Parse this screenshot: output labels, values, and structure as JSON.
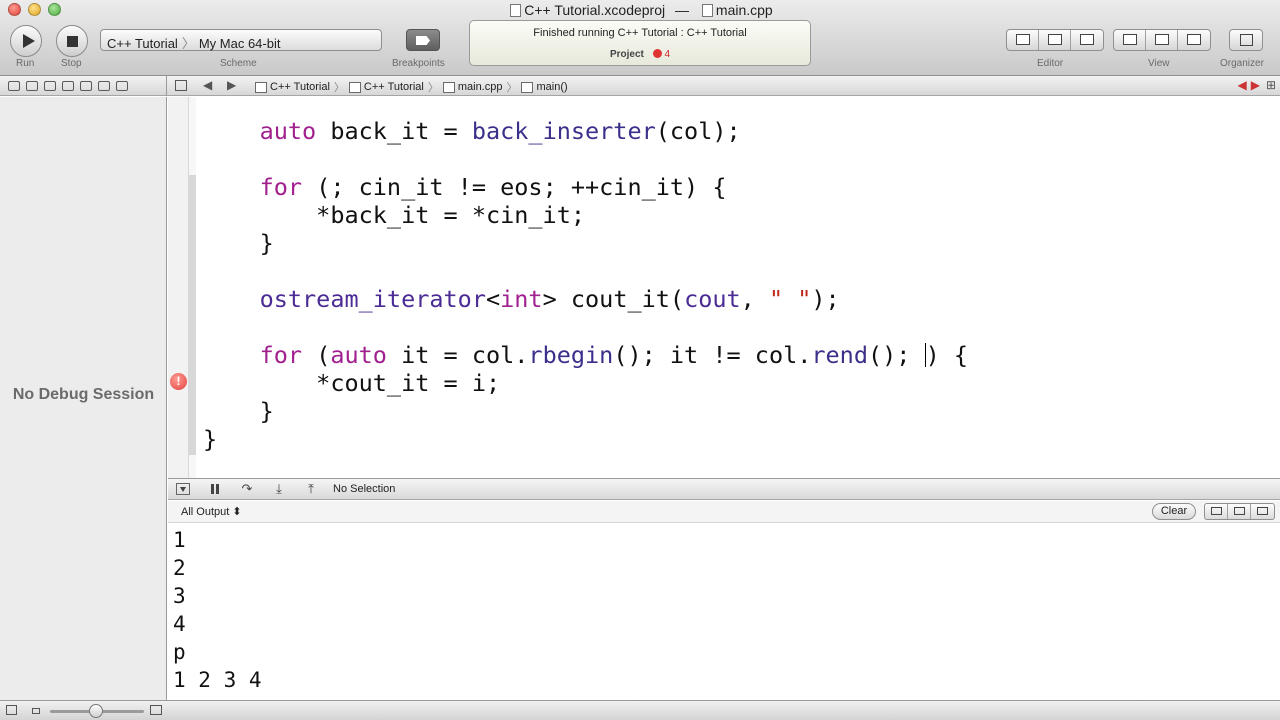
{
  "window": {
    "project_file": "C++ Tutorial.xcodeproj",
    "dash": "—",
    "open_file": "main.cpp"
  },
  "toolbar": {
    "run_label": "Run",
    "stop_label": "Stop",
    "scheme_label": "Scheme",
    "scheme_target": "C++ Tutorial",
    "scheme_destination": "My Mac 64-bit",
    "breakpoints_label": "Breakpoints",
    "editor_label": "Editor",
    "view_label": "View",
    "organizer_label": "Organizer"
  },
  "activity": {
    "status": "Finished running C++ Tutorial : C++ Tutorial",
    "project_label": "Project",
    "error_count": "4"
  },
  "jump_bar": {
    "crumbs": [
      "C++ Tutorial",
      "C++ Tutorial",
      "main.cpp",
      "main()"
    ]
  },
  "debug": {
    "no_session": "No Debug Session",
    "selection": "No Selection"
  },
  "code": {
    "lines": [
      [
        "    ",
        {
          "k": "kw",
          "t": "auto"
        },
        " back_it = ",
        {
          "k": "fn",
          "t": "back_inserter"
        },
        "(col);"
      ],
      [
        ""
      ],
      [
        "    ",
        {
          "k": "kw",
          "t": "for"
        },
        " (; cin_it != eos; ++cin_it) {"
      ],
      [
        "        *back_it = *cin_it;"
      ],
      [
        "    }"
      ],
      [
        ""
      ],
      [
        "    ",
        {
          "k": "ty",
          "t": "ostream_iterator"
        },
        "<",
        {
          "k": "kw",
          "t": "int"
        },
        "> cout_it(",
        {
          "k": "ty",
          "t": "cout"
        },
        ", ",
        {
          "k": "st",
          "t": "\" \""
        },
        ");"
      ],
      [
        ""
      ],
      [
        "    ",
        {
          "k": "kw",
          "t": "for"
        },
        " (",
        {
          "k": "kw",
          "t": "auto"
        },
        " it = col.",
        {
          "k": "fn",
          "t": "rbegin"
        },
        "(); it != col.",
        {
          "k": "fn",
          "t": "rend"
        },
        "(); ",
        {
          "k": "cursor",
          "t": ""
        },
        ") {"
      ],
      [
        "        *cout_it = i;"
      ],
      [
        "    }"
      ],
      [
        "}"
      ]
    ],
    "issue_glyph": "!"
  },
  "console": {
    "filter_label": "All Output ⬍",
    "clear_label": "Clear",
    "output_lines": [
      "1",
      "2",
      "3",
      "4",
      "p",
      "1 2 3 4"
    ]
  },
  "icons": {
    "jump_back": "◀",
    "jump_forward": "▶",
    "step_over": "↷",
    "step_into": "⤓",
    "step_out": "⤒",
    "issue_prev": "◀",
    "issue_next": "▶",
    "add_editor": "⊞"
  },
  "colors": {
    "keyword": "#a1208f",
    "type": "#4b2b94",
    "function": "#3a2f8a",
    "string": "#c2261b",
    "error": "#e0433b"
  }
}
